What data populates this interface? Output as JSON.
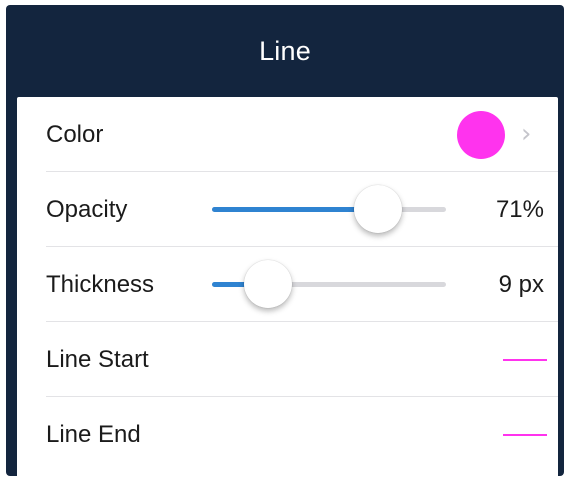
{
  "title": "Line",
  "accent_color": "#2f83d1",
  "header_color": "#13253e",
  "rows": {
    "color": {
      "label": "Color",
      "swatch_color": "#ff33ee",
      "chevron_icon": "chevron-right-icon"
    },
    "opacity": {
      "label": "Opacity",
      "value_percent": 71,
      "value_text": "71%"
    },
    "thickness": {
      "label": "Thickness",
      "value_fraction": 0.24,
      "value_text": "9 px"
    },
    "line_start": {
      "label": "Line Start",
      "preview_color": "#ff33ee"
    },
    "line_end": {
      "label": "Line End",
      "preview_color": "#ff33ee"
    }
  }
}
